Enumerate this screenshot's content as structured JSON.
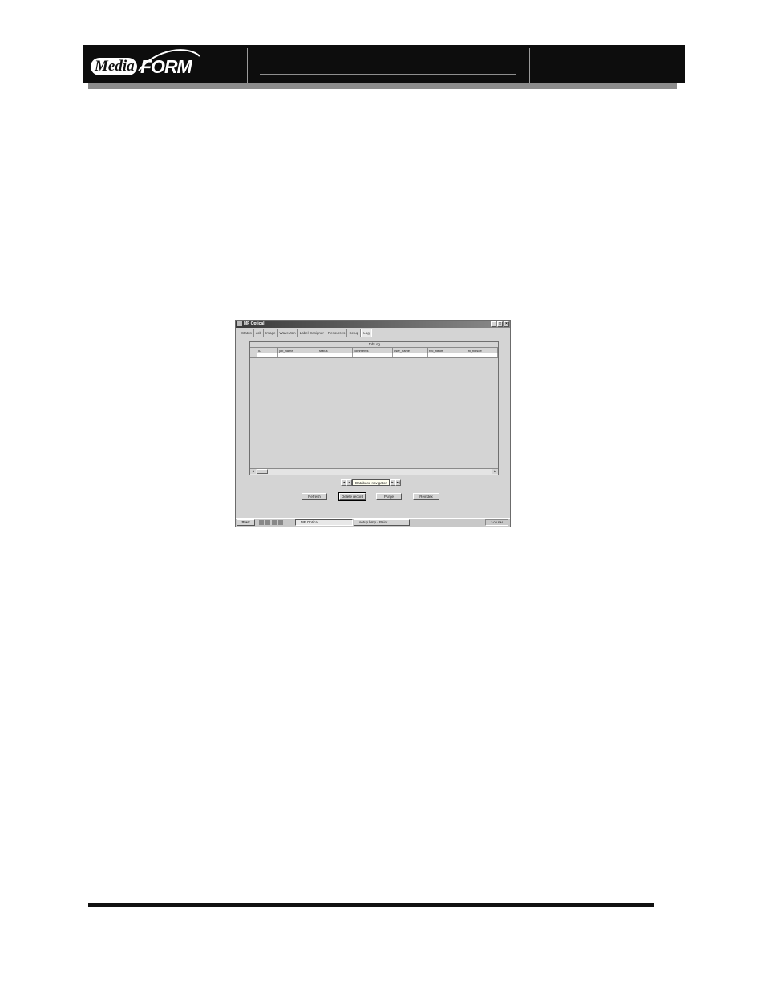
{
  "header": {
    "logo_media": "Media",
    "logo_form": "FORM"
  },
  "window": {
    "title": "MF Optical",
    "controls": [
      "_",
      "□",
      "×"
    ]
  },
  "tabs": [
    {
      "label": "Status",
      "active": false
    },
    {
      "label": "Job",
      "active": false
    },
    {
      "label": "Image",
      "active": false
    },
    {
      "label": "WaveMan",
      "active": false
    },
    {
      "label": "Label Designer",
      "active": false
    },
    {
      "label": "Resources",
      "active": false
    },
    {
      "label": "Setup",
      "active": false
    },
    {
      "label": "Log",
      "active": true
    }
  ],
  "grid": {
    "caption": "JobLog",
    "columns": [
      "ID",
      "job_name",
      "status",
      "comments",
      "user_name",
      "rec_fileoff",
      "fil_filesoff"
    ]
  },
  "navigator": {
    "first": "|◄",
    "prior": "◄",
    "hint": "Database navigator",
    "next": "►",
    "last": "►|"
  },
  "buttons": {
    "refresh": "Refresh",
    "delete_record": "Delete record",
    "purge": "Purge",
    "reindex": "Reindex"
  },
  "taskbar": {
    "start": "Start",
    "tasks": [
      "MF Optical",
      "setup.bmp - Paint"
    ],
    "clock": "1:08 PM"
  },
  "colors": {
    "header_band": "#0d0d0d",
    "window_face": "#d4d4d4"
  }
}
